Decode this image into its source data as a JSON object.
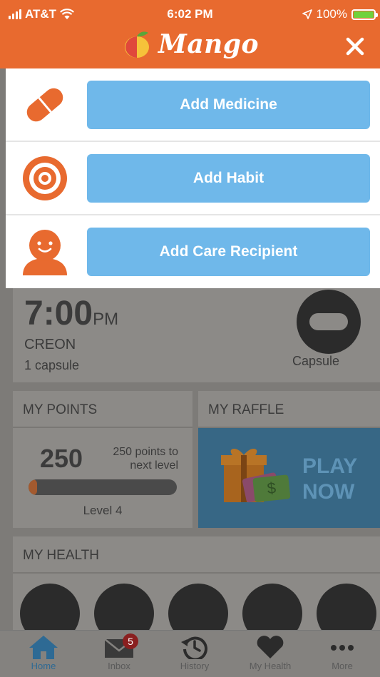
{
  "status_bar": {
    "carrier": "AT&T",
    "time": "6:02 PM",
    "battery": "100%",
    "battery_level": 1.0
  },
  "header": {
    "app_name": "Mango",
    "accent_color": "#e86a2f"
  },
  "add_menu": {
    "items": [
      {
        "label": "Add Medicine",
        "icon": "pill-icon"
      },
      {
        "label": "Add Habit",
        "icon": "target-icon"
      },
      {
        "label": "Add Care Recipient",
        "icon": "person-icon"
      }
    ],
    "button_color": "#6fb8ea"
  },
  "dose": {
    "time": "7:00",
    "ampm": "PM",
    "medicine": "CREON",
    "quantity": "1 capsule",
    "form": "Capsule"
  },
  "points": {
    "title": "MY POINTS",
    "value": "250",
    "next_level": "250 points to next level",
    "progress": 0.06,
    "level": "Level 4"
  },
  "raffle": {
    "title": "MY RAFFLE",
    "play_line1": "PLAY",
    "play_line2": "NOW"
  },
  "health": {
    "title": "MY HEALTH"
  },
  "tabs": [
    {
      "label": "Home",
      "icon": "home-icon",
      "active": true
    },
    {
      "label": "Inbox",
      "icon": "mail-icon",
      "badge": "5"
    },
    {
      "label": "History",
      "icon": "history-icon"
    },
    {
      "label": "My Health",
      "icon": "heart-icon"
    },
    {
      "label": "More",
      "icon": "more-icon"
    }
  ]
}
